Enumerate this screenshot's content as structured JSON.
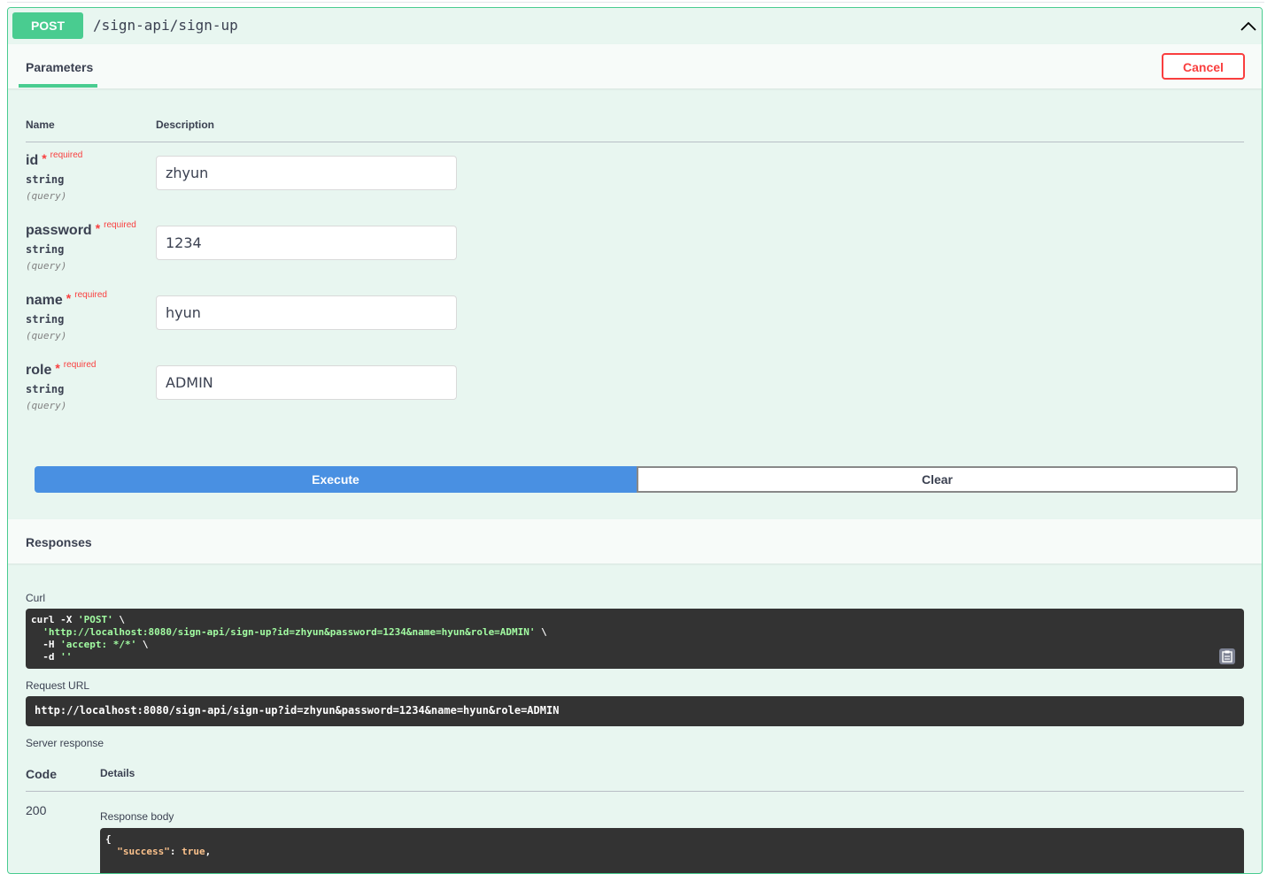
{
  "operation": {
    "method": "POST",
    "path": "/sign-api/sign-up"
  },
  "parameters_section": {
    "tab_label": "Parameters",
    "cancel_label": "Cancel",
    "col_name": "Name",
    "col_description": "Description",
    "required_label": "required",
    "params": [
      {
        "name": "id",
        "type": "string",
        "in": "(query)",
        "value": "zhyun"
      },
      {
        "name": "password",
        "type": "string",
        "in": "(query)",
        "value": "1234"
      },
      {
        "name": "name",
        "type": "string",
        "in": "(query)",
        "value": "hyun"
      },
      {
        "name": "role",
        "type": "string",
        "in": "(query)",
        "value": "ADMIN"
      }
    ]
  },
  "actions": {
    "execute_label": "Execute",
    "clear_label": "Clear"
  },
  "responses": {
    "title": "Responses",
    "curl_label": "Curl",
    "curl_lines": [
      "curl -X 'POST' \\",
      "  'http://localhost:8080/sign-api/sign-up?id=zhyun&password=1234&name=hyun&role=ADMIN' \\",
      "  -H 'accept: */*' \\",
      "  -d ''"
    ],
    "request_url_label": "Request URL",
    "request_url": "http://localhost:8080/sign-api/sign-up?id=zhyun&password=1234&name=hyun&role=ADMIN",
    "server_response_label": "Server response",
    "code_header": "Code",
    "details_header": "Details",
    "status_code": "200",
    "response_body_label": "Response body",
    "response_body_lines": [
      "{",
      "  \"success\": true,"
    ]
  },
  "icons": {
    "collapse": "chevron-up-icon",
    "copy": "copy-to-clipboard-icon"
  },
  "colors": {
    "post_green": "#49cc90",
    "post_bg": "#e8f6f0",
    "execute_blue": "#4990e2",
    "cancel_red": "#f93e3e",
    "code_bg": "#333333",
    "string_green": "#a2fca2"
  }
}
